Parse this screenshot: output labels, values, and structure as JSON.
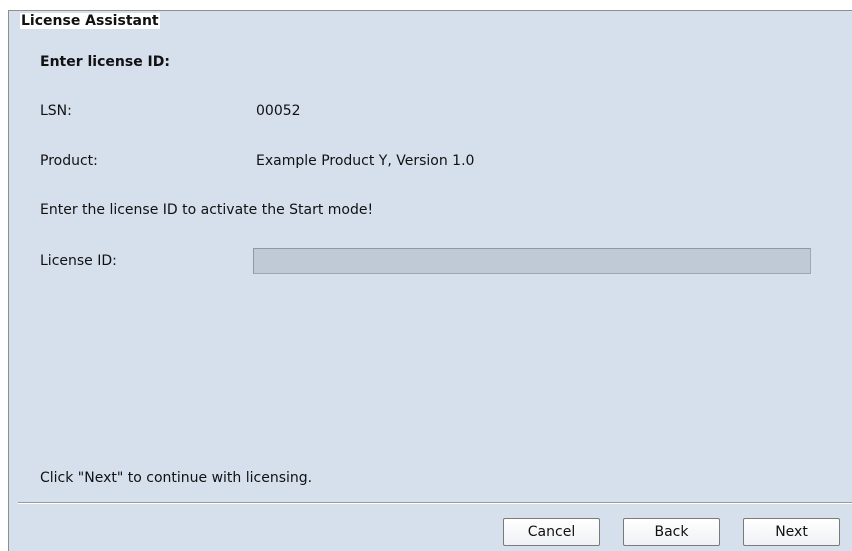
{
  "dialog": {
    "title": "License Assistant",
    "heading": "Enter license ID:"
  },
  "fields": {
    "lsn_label": "LSN:",
    "lsn_value": "00052",
    "product_label": "Product:",
    "product_value": "Example Product Y, Version  1.0"
  },
  "instruction": "Enter the license ID to activate the Start mode!",
  "license_id": {
    "label": "License ID:",
    "value": "",
    "placeholder": ""
  },
  "footer_note": "Click \"Next\" to continue with licensing.",
  "buttons": {
    "cancel": "Cancel",
    "back": "Back",
    "next": "Next"
  }
}
